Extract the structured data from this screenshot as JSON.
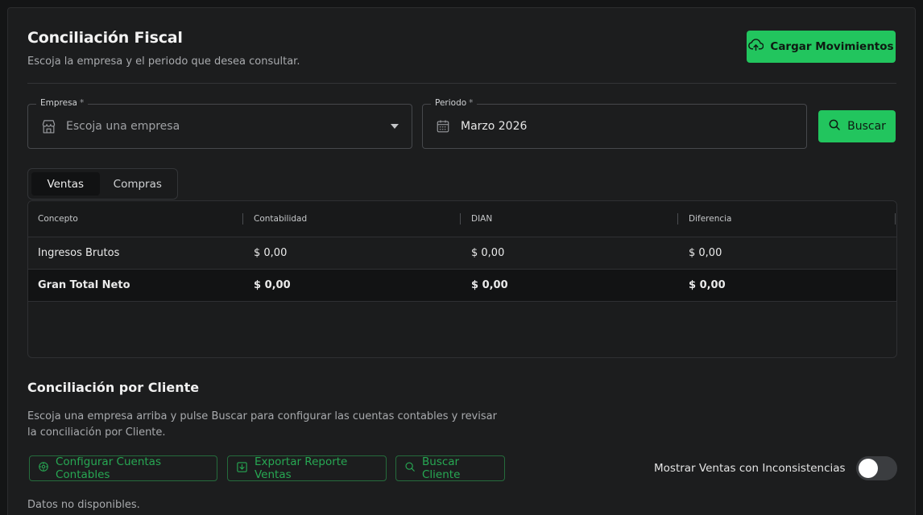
{
  "header": {
    "title": "Conciliación Fiscal",
    "subtitle": "Escoja la empresa y el periodo que desea consultar.",
    "upload_label": "Cargar Movimientos"
  },
  "filters": {
    "empresa": {
      "label": "Empresa",
      "required_mark": "*",
      "placeholder": "Escoja una empresa"
    },
    "periodo": {
      "label": "Periodo",
      "required_mark": "*",
      "value": "Marzo 2026"
    },
    "search_label": "Buscar"
  },
  "tabs": [
    {
      "label": "Ventas",
      "active": true
    },
    {
      "label": "Compras",
      "active": false
    }
  ],
  "table": {
    "columns": [
      "Concepto",
      "Contabilidad",
      "DIAN",
      "Diferencia"
    ],
    "rows": [
      [
        "Ingresos Brutos",
        "$ 0,00",
        "$ 0,00",
        "$ 0,00"
      ]
    ],
    "total": [
      "Gran Total Neto",
      "$ 0,00",
      "$ 0,00",
      "$ 0,00"
    ]
  },
  "cliente_section": {
    "title": "Conciliación por Cliente",
    "description": "Escoja una empresa arriba y pulse Buscar para configurar las cuentas contables y revisar la conciliación por Cliente.",
    "buttons": {
      "config": "Configurar Cuentas Contables",
      "export": "Exportar Reporte Ventas",
      "client": "Buscar Cliente"
    },
    "toggle_label": "Mostrar Ventas con Inconsistencias",
    "toggle_on": false,
    "no_data": "Datos no disponibles."
  },
  "icons": {
    "upload": "cloud-upload-icon",
    "store": "store-icon",
    "calendar": "calendar-icon",
    "search": "search-icon",
    "settings": "gear-icon",
    "download": "download-icon"
  },
  "colors": {
    "accent": "#22c55e",
    "outline_accent": "#27a853",
    "background": "#1c1d1e"
  }
}
